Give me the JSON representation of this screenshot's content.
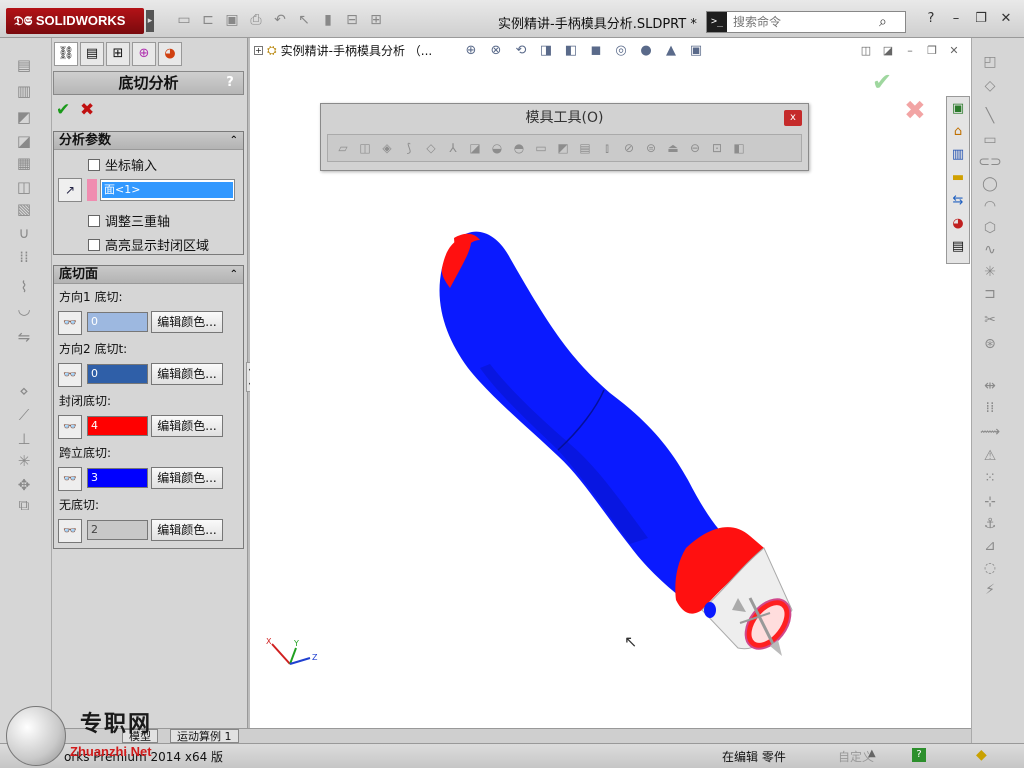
{
  "app": {
    "logo_text": "SOLIDWORKS",
    "document_title": "实例精讲-手柄模具分析.SLDPRT *",
    "search_placeholder": "搜索命令"
  },
  "property_manager": {
    "title": "底切分析",
    "help": "?",
    "analysis_params": {
      "title": "分析参数",
      "coordinate_input": "坐标输入",
      "selection_item": "面<1>",
      "adjust_triad": "调整三重轴",
      "highlight_closed": "高亮显示封闭区域"
    },
    "undercut_faces": {
      "title": "底切面",
      "edit_color_label": "编辑颜色...",
      "rows": [
        {
          "label": "方向1 底切:",
          "count": "0",
          "color": "#9db8e0"
        },
        {
          "label": "方向2 底切t:",
          "count": "0",
          "color": "#2f5fa8"
        },
        {
          "label": "封闭底切:",
          "count": "4",
          "color": "#ff0000"
        },
        {
          "label": "跨立底切:",
          "count": "3",
          "color": "#0000ff"
        },
        {
          "label": "无底切:",
          "count": "2",
          "color": "#c8c8c8"
        }
      ]
    }
  },
  "viewport": {
    "tree_node": "实例精讲-手柄模具分析 （...",
    "toolbar": {
      "title": "模具工具(O)",
      "close": "x"
    },
    "triad": {
      "x": "X",
      "y": "Y",
      "z": "Z"
    }
  },
  "bottom_tabs": [
    "模型",
    "运动算例 1"
  ],
  "status": {
    "version": "orks Premium 2014 x64 版",
    "editing": "在编辑 零件",
    "custom": "自定义"
  },
  "watermark": {
    "cn": "专职网",
    "en": "Zhuanzhi Net"
  },
  "colors": {
    "body_blue": "#0a1aff",
    "undercut_red": "#ff1010",
    "no_undercut": "#e0e0e0"
  }
}
